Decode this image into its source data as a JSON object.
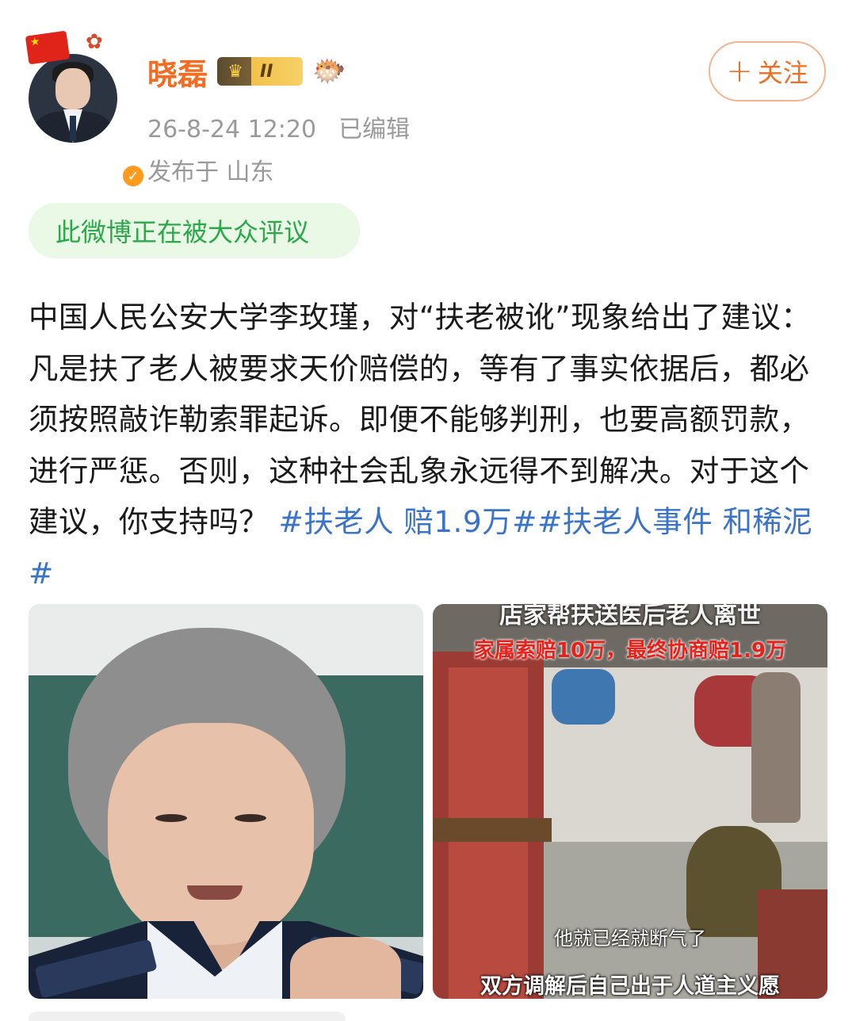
{
  "author": {
    "name": "晓磊",
    "level": "II",
    "verified_icon": "verified-badge-icon",
    "timestamp": "26-8-24 12:20",
    "edited": "已编辑",
    "location": "发布于 山东"
  },
  "follow_button": {
    "plus": "+",
    "label": "关注"
  },
  "hot_banner": "此微博正在被大众评议",
  "post": {
    "text": "中国人民公安大学李玫瑾，对“扶老被讹”现象给出了建议：凡是扶了老人被要求天价赔偿的，等有了事实依据后，都必须按照敲诈勒索罪起诉。即便不能够判刑，也要高额罚款，进行严惩。否则，这种社会乱象永远得不到解决。对于这个建议，你支持吗？",
    "hashtag1": "#扶老人 赔1.9万#",
    "hashtag2": "#扶老人事件 和稀泥#"
  },
  "images": {
    "right": {
      "caption_top": "店家帮扶送医后老人离世",
      "caption_red": "家属索赔10万，最终协商赔1.9万",
      "subtitle1": "他就已经就断气了",
      "subtitle2": "双方调解后自己出于人道主义愿"
    }
  },
  "colors": {
    "username": "#f26d23",
    "hashtag": "#3b74c7",
    "banner_text": "#2aa84a",
    "banner_bg": "#eaf8e6"
  }
}
